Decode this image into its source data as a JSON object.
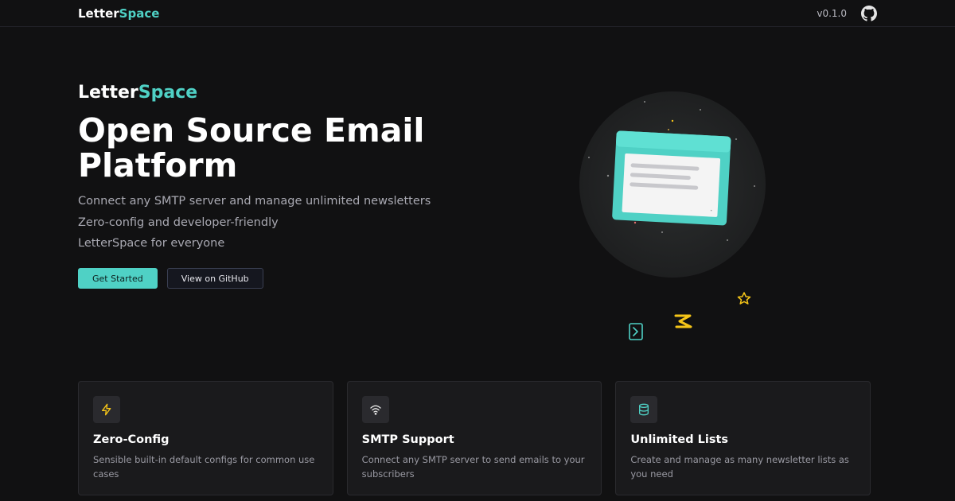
{
  "header": {
    "brand_main": "Letter",
    "brand_accent": "Space",
    "version": "v0.1.0",
    "github_icon": "github-icon"
  },
  "hero": {
    "brand_main": "Letter",
    "brand_accent": "Space",
    "title": "Open Source Email Platform",
    "lines": [
      "Connect any SMTP server and manage unlimited newsletters",
      "Zero-config and developer-friendly",
      "LetterSpace for everyone"
    ],
    "primary_button": "Get Started",
    "secondary_button": "View on GitHub"
  },
  "features": [
    {
      "icon": "lightning-icon",
      "title": "Zero-Config",
      "desc": "Sensible built-in default configs for common use cases"
    },
    {
      "icon": "wifi-icon",
      "title": "SMTP Support",
      "desc": "Connect any SMTP server to send emails to your subscribers"
    },
    {
      "icon": "database-icon",
      "title": "Unlimited Lists",
      "desc": "Create and manage as many newsletter lists as you need"
    }
  ],
  "colors": {
    "accent": "#4fd1c5",
    "background": "#111112",
    "card": "#1a1a1c",
    "yellow": "#f5c518"
  }
}
